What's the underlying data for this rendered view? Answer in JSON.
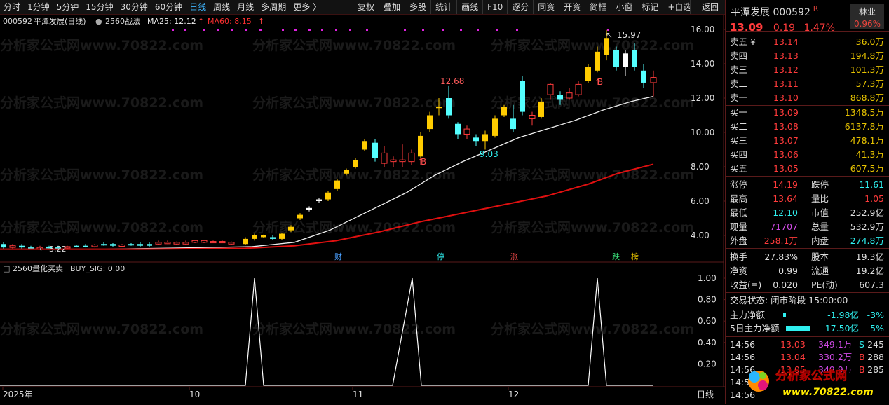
{
  "toolbar": {
    "left_items": [
      "分时",
      "1分钟",
      "5分钟",
      "15分钟",
      "30分钟",
      "60分钟",
      "日线",
      "周线",
      "月线",
      "多周期",
      "更多 〉"
    ],
    "active_index": 6,
    "right_items": [
      "复权",
      "叠加",
      "多股",
      "统计",
      "画线",
      "F10",
      "逐分",
      "同资",
      "开资",
      "简框",
      "小窗",
      "标记",
      "+自选"
    ],
    "back_label": "返回"
  },
  "main_chart": {
    "header_code": "000592",
    "header_name": "平潭发展(日线)",
    "header_strategy": "2560战法",
    "ma25_label": "MA25: 12.12",
    "ma60_label": "MA60: 8.15",
    "arrow_glyph": "↑",
    "y_ticks": [
      "16.00",
      "14.00",
      "12.00",
      "10.00",
      "8.00",
      "6.00",
      "4.00"
    ],
    "annotations": {
      "high1": "12.68",
      "low1": "9.03",
      "high2": "15.97",
      "low_start": "3.22",
      "buy_mark": "B"
    },
    "event_tags": [
      {
        "label": "财",
        "color": "#4aa0ff"
      },
      {
        "label": "停",
        "color": "#2ff0f0"
      },
      {
        "label": "涨",
        "color": "#ff4d4d"
      },
      {
        "label": "跌",
        "color": "#3ae07a"
      },
      {
        "label": "榜",
        "color": "#e5c100"
      }
    ],
    "watermark": "分析家公式网www.70822.com"
  },
  "chart_data": {
    "type": "line",
    "title": "2560量化买卖",
    "indicator_label": "BUY_SIG: 0.00",
    "x_ticks": [
      "2025年",
      "10",
      "11",
      "12"
    ],
    "y_ticks": [
      "1.00",
      "0.80",
      "0.60",
      "0.40",
      "0.20"
    ],
    "ylim": [
      0,
      1.1
    ],
    "series": [
      {
        "name": "BUY_SIG",
        "x": [
          0,
          1,
          2,
          3,
          4,
          5,
          6,
          7,
          8,
          9,
          10,
          11,
          12,
          13,
          14,
          15,
          16,
          17,
          18,
          19,
          20,
          21,
          22,
          23,
          24
        ],
        "values": [
          0,
          0,
          0,
          0,
          0,
          0,
          0,
          0,
          0,
          0,
          1,
          0,
          0,
          0,
          0,
          1,
          0,
          0,
          0,
          0,
          0,
          0,
          1,
          0,
          0
        ]
      }
    ],
    "period_label": "日线"
  },
  "panel": {
    "name": "平潭发展",
    "code": "000592",
    "r_badge": "R",
    "industry": "林业",
    "industry_pct": "0.96%",
    "price": "13.09",
    "change": "0.19",
    "change_pct": "1.47%",
    "sell": [
      {
        "label": "卖五 ¥",
        "price": "13.14",
        "vol": "36.0万"
      },
      {
        "label": "卖四",
        "price": "13.13",
        "vol": "194.8万"
      },
      {
        "label": "卖三",
        "price": "13.12",
        "vol": "101.3万"
      },
      {
        "label": "卖二",
        "price": "13.11",
        "vol": "57.3万"
      },
      {
        "label": "卖一",
        "price": "13.10",
        "vol": "868.8万"
      }
    ],
    "buy": [
      {
        "label": "买一",
        "price": "13.09",
        "vol": "1348.5万"
      },
      {
        "label": "买二",
        "price": "13.08",
        "vol": "6137.8万"
      },
      {
        "label": "买三",
        "price": "13.07",
        "vol": "478.1万"
      },
      {
        "label": "买四",
        "price": "13.06",
        "vol": "41.3万"
      },
      {
        "label": "买五",
        "price": "13.05",
        "vol": "607.5万"
      }
    ],
    "stats1": [
      {
        "l1": "涨停",
        "v1": "14.19",
        "c1": "red",
        "l2": "跌停",
        "v2": "11.61",
        "c2": "cyan"
      },
      {
        "l1": "最高",
        "v1": "13.64",
        "c1": "red",
        "l2": "量比",
        "v2": "1.05",
        "c2": "red"
      },
      {
        "l1": "最低",
        "v1": "12.10",
        "c1": "cyan",
        "l2": "市值",
        "v2": "252.9亿",
        "c2": "white"
      },
      {
        "l1": "现量",
        "v1": "71707",
        "c1": "magenta",
        "l2": "总量",
        "v2": "532.9万",
        "c2": "white"
      },
      {
        "l1": "外盘",
        "v1": "258.1万",
        "c1": "red",
        "l2": "内盘",
        "v2": "274.8万",
        "c2": "cyan"
      }
    ],
    "stats2": [
      {
        "l1": "换手",
        "v1": "27.83%",
        "c1": "white",
        "l2": "股本",
        "v2": "19.3亿",
        "c2": "white"
      },
      {
        "l1": "净资",
        "v1": "0.99",
        "c1": "white",
        "l2": "流通",
        "v2": "19.2亿",
        "c2": "white"
      },
      {
        "l1": "收益(≡)",
        "v1": "0.020",
        "c1": "white",
        "l2": "PE(动)",
        "v2": "607.3",
        "c2": "white"
      }
    ],
    "status": "交易状态: 闭市阶段 15:00:00",
    "flow": [
      {
        "label": "主力净额",
        "value": "-1.98亿",
        "pct": "-3%",
        "bar": 4
      },
      {
        "label": "5日主力净额",
        "value": "-17.50亿",
        "pct": "-5%",
        "bar": 34
      }
    ],
    "ticks": [
      {
        "time": "14:56",
        "price": "13.03",
        "vol": "349.1万",
        "side": "S",
        "num": "245"
      },
      {
        "time": "14:56",
        "price": "13.04",
        "vol": "330.2万",
        "side": "B",
        "num": "288"
      },
      {
        "time": "14:56",
        "price": "13.05",
        "vol": "349.9万",
        "side": "B",
        "num": "285"
      },
      {
        "time": "14:56",
        "price": "",
        "vol": "",
        "side": "",
        "num": ""
      },
      {
        "time": "14:56",
        "price": "",
        "vol": "",
        "side": "",
        "num": ""
      }
    ],
    "logo_text": "分析家公式网",
    "logo_url_text": "www.70822.com"
  }
}
